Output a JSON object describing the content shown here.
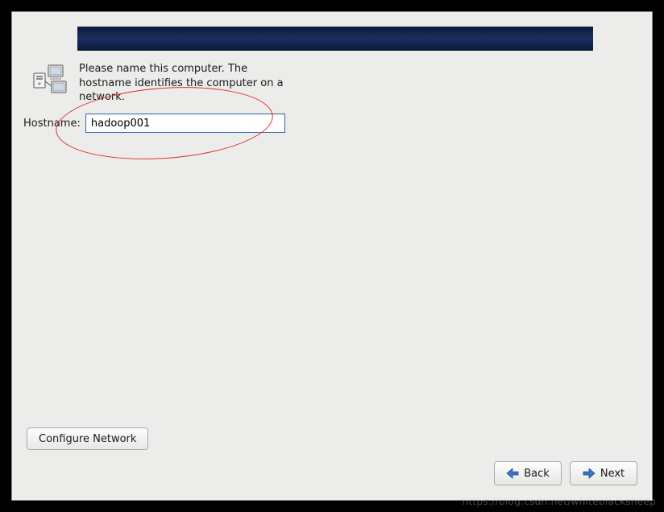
{
  "intro": {
    "text": "Please name this computer.  The hostname identifies the computer on a network."
  },
  "hostname": {
    "label": "Hostname:",
    "value": "hadoop001"
  },
  "buttons": {
    "configure_network": "Configure Network",
    "back": "Back",
    "next": "Next"
  },
  "watermark": "https://blog.csdn.net/whiteblacksheep"
}
